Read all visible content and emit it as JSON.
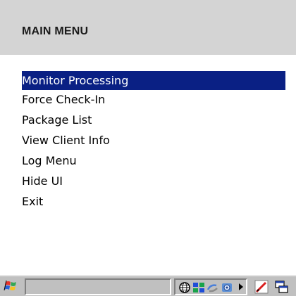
{
  "header": {
    "title": "MAIN MENU"
  },
  "menu": {
    "items": [
      {
        "label": "Monitor Processing",
        "selected": true
      },
      {
        "label": "Force Check-In",
        "selected": false
      },
      {
        "label": "Package List",
        "selected": false
      },
      {
        "label": "View Client Info",
        "selected": false
      },
      {
        "label": "Log Menu",
        "selected": false
      },
      {
        "label": "Hide UI",
        "selected": false
      },
      {
        "label": "Exit",
        "selected": false
      }
    ]
  },
  "colors": {
    "header_bg": "#d4d4d4",
    "selection_bg": "#0a2084",
    "taskbar_bg": "#c0c0c0"
  },
  "taskbar": {
    "start_icon": "windows-flag-icon",
    "tray_icons": [
      "network-globe-icon",
      "connection-icon",
      "sync-icon",
      "gear-app-icon"
    ],
    "quick_icons": [
      "pen-input-icon",
      "windows-switch-icon"
    ]
  }
}
